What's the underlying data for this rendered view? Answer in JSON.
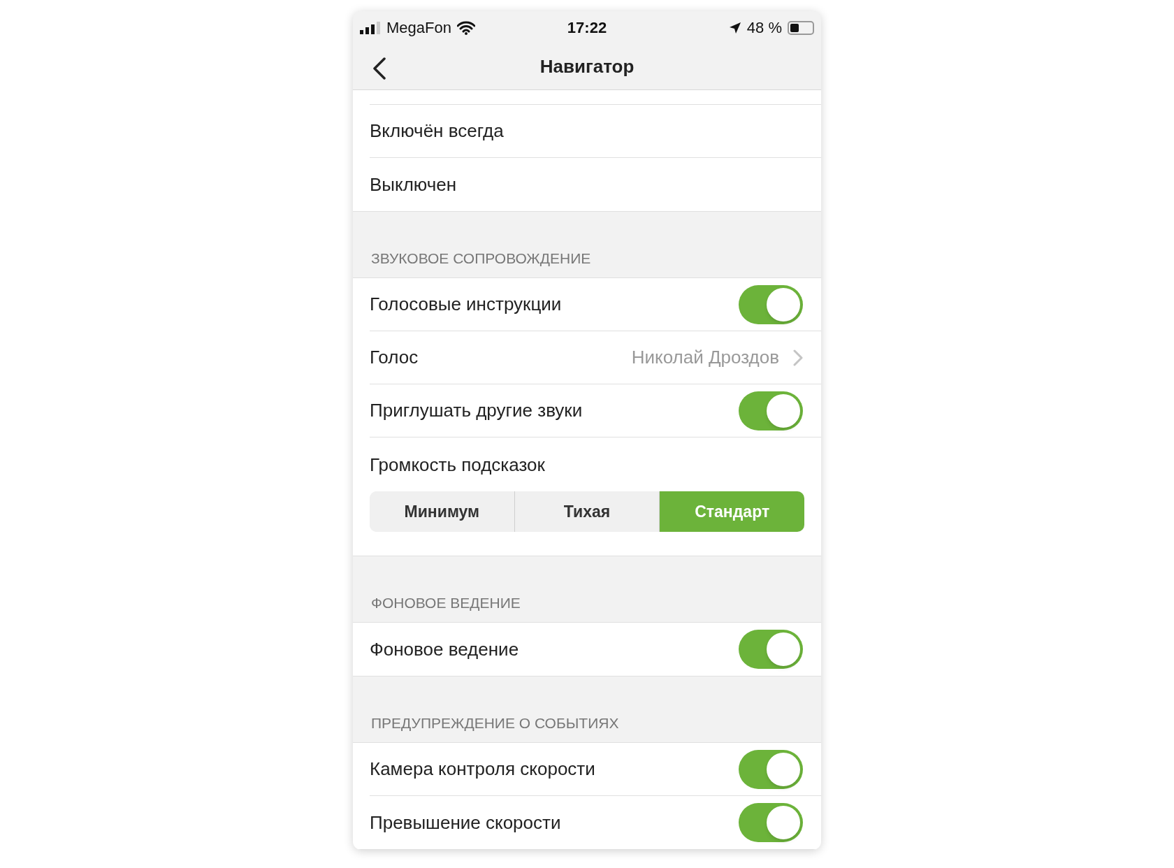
{
  "status_bar": {
    "carrier": "MegaFon",
    "time": "17:22",
    "battery": "48 %"
  },
  "nav": {
    "title": "Навигатор"
  },
  "sections": [
    {
      "rows": [
        {
          "kind": "plain",
          "label": "Включён всегда"
        },
        {
          "kind": "plain",
          "label": "Выключен"
        }
      ]
    },
    {
      "header": "ЗВУКОВОЕ СОПРОВОЖДЕНИЕ",
      "rows": [
        {
          "kind": "toggle",
          "label": "Голосовые инструкции",
          "on": true
        },
        {
          "kind": "link",
          "label": "Голос",
          "value": "Николай Дроздов"
        },
        {
          "kind": "toggle",
          "label": "Приглушать другие звуки",
          "on": true
        },
        {
          "kind": "segmented",
          "label": "Громкость подсказок",
          "options": [
            {
              "label": "Минимум",
              "selected": false
            },
            {
              "label": "Тихая",
              "selected": false
            },
            {
              "label": "Стандарт",
              "selected": true
            }
          ]
        }
      ]
    },
    {
      "header": "ФОНОВОЕ ВЕДЕНИЕ",
      "rows": [
        {
          "kind": "toggle",
          "label": "Фоновое ведение",
          "on": true
        }
      ]
    },
    {
      "header": "ПРЕДУПРЕЖДЕНИЕ О СОБЫТИЯХ",
      "rows": [
        {
          "kind": "toggle",
          "label": "Камера контроля скорости",
          "on": true
        },
        {
          "kind": "toggle",
          "label": "Превышение скорости",
          "on": true
        }
      ]
    }
  ]
}
